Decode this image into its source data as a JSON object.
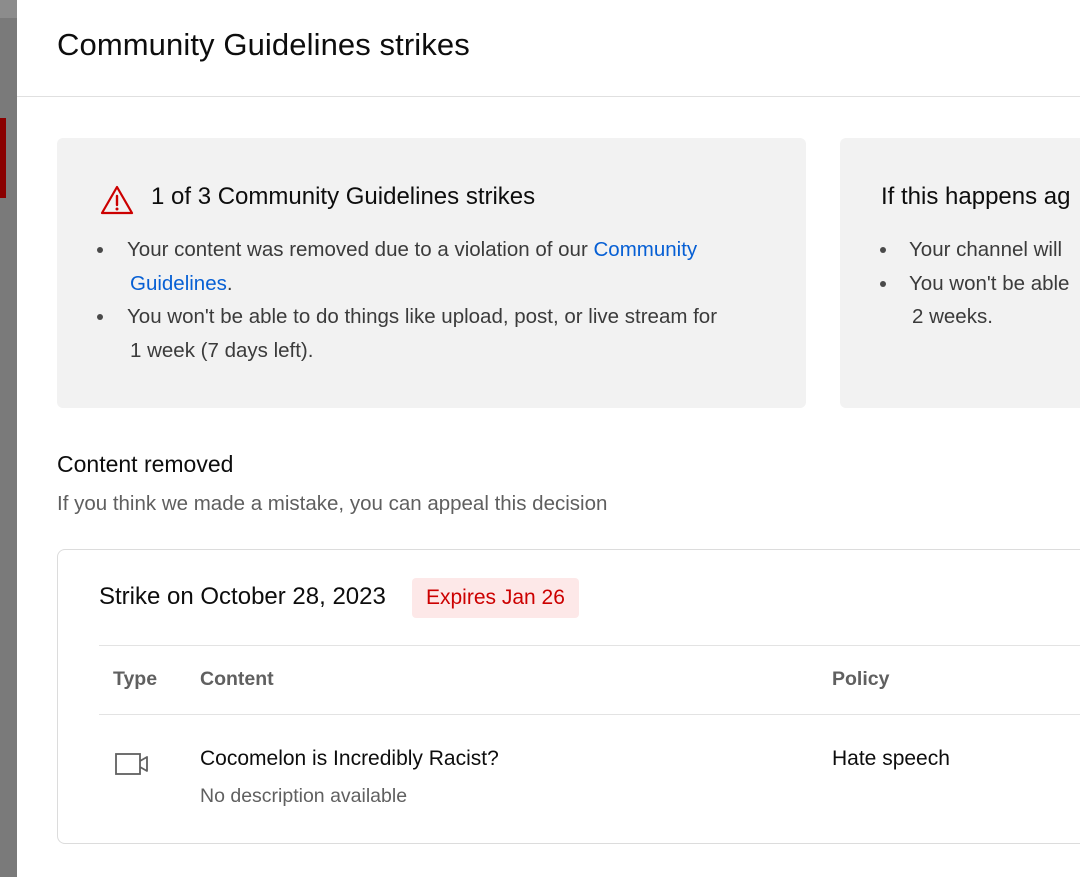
{
  "dialog": {
    "title": "Community Guidelines strikes"
  },
  "current_strike_card": {
    "icon": "warning-triangle-icon",
    "heading": "1 of 3 Community Guidelines strikes",
    "bullets": [
      {
        "text_before": "Your content was removed due to a violation of our ",
        "link_part1": "Community",
        "link_part2": "Guidelines",
        "text_after": "."
      },
      {
        "line1": "You won't be able to do things like upload, post, or live stream for",
        "line2": "1 week (7 days left)."
      }
    ]
  },
  "next_strike_card": {
    "heading": "If this happens ag",
    "bullets": [
      {
        "line1": "Your channel will "
      },
      {
        "line1": "You won't be able",
        "line2": "2 weeks."
      }
    ]
  },
  "content_removed": {
    "title": "Content removed",
    "subtitle": "If you think we made a mistake, you can appeal this decision"
  },
  "strike": {
    "title": "Strike on October 28, 2023",
    "badge": "Expires Jan 26",
    "columns": [
      "Type",
      "Content",
      "Policy"
    ],
    "row": {
      "type_icon": "video-icon",
      "content_title": "Cocomelon is Incredibly Racist?",
      "content_description": "No description available",
      "policy": "Hate speech"
    }
  },
  "colors": {
    "link": "#065fd4",
    "warning_red": "#cc0000",
    "badge_bg": "#fde8e8",
    "card_bg": "#f2f2f2"
  }
}
